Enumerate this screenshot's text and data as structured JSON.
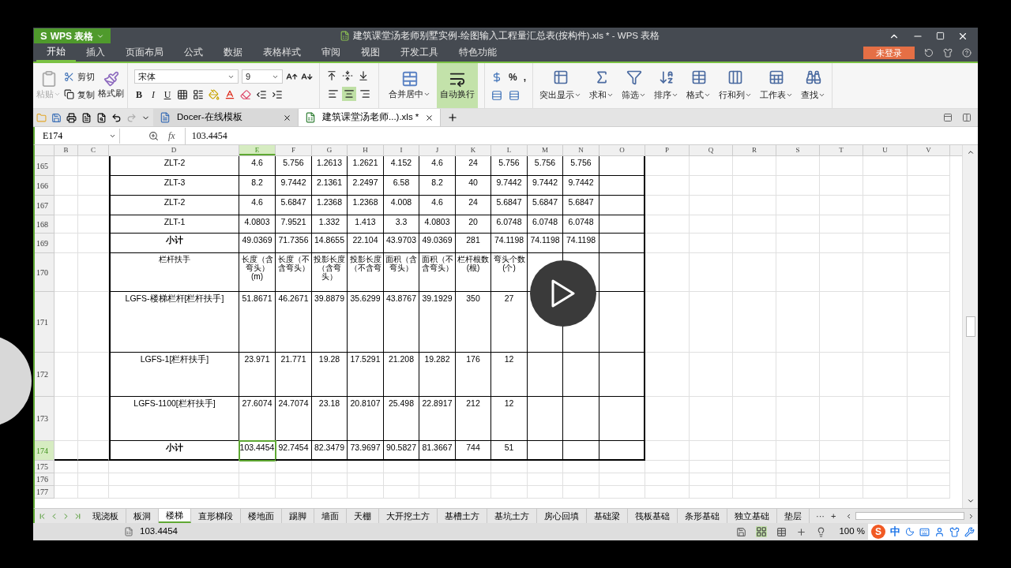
{
  "app": {
    "logo": "S",
    "name": "WPS 表格"
  },
  "window": {
    "title": "建筑课堂汤老师别墅实例-绘图输入工程量汇总表(按构件).xls * - WPS 表格"
  },
  "menu_tabs": [
    {
      "label": "开始",
      "selected": true
    },
    {
      "label": "插入",
      "selected": false
    },
    {
      "label": "页面布局",
      "selected": false
    },
    {
      "label": "公式",
      "selected": false
    },
    {
      "label": "数据",
      "selected": false
    },
    {
      "label": "表格样式",
      "selected": false
    },
    {
      "label": "审阅",
      "selected": false
    },
    {
      "label": "视图",
      "selected": false
    },
    {
      "label": "开发工具",
      "selected": false
    },
    {
      "label": "特色功能",
      "selected": false
    }
  ],
  "login_button": "未登录",
  "ribbon": {
    "paste": {
      "label": "粘贴",
      "disabled": true
    },
    "cut": "剪切",
    "copy": "复制",
    "format_painter": "格式刷",
    "font_name": "宋体",
    "font_size": "9",
    "styles": [
      "B",
      "I",
      "U"
    ],
    "horizontal_align": [
      {
        "selected": false
      },
      {
        "selected": true
      },
      {
        "selected": false
      }
    ],
    "merge": "合并居中",
    "wrap": {
      "label": "自动换行",
      "on": true
    },
    "number_symbols": [
      "%",
      ","
    ],
    "tools": [
      "突出显示",
      "求和",
      "筛选",
      "排序",
      "格式",
      "行和列",
      "工作表",
      "查找"
    ]
  },
  "doc_tabs": [
    {
      "label": "Docer-在线模板",
      "selected": false
    },
    {
      "label": "建筑课堂汤老师...).xls *",
      "selected": true
    }
  ],
  "formula_bar": {
    "name_box": "E174",
    "fx": "fx",
    "value": "103.4454"
  },
  "columns": [
    {
      "label": "B",
      "selected": false
    },
    {
      "label": "C",
      "selected": false
    },
    {
      "label": "D",
      "selected": false
    },
    {
      "label": "E",
      "selected": true
    },
    {
      "label": "F",
      "selected": false
    },
    {
      "label": "G",
      "selected": false
    },
    {
      "label": "H",
      "selected": false
    },
    {
      "label": "I",
      "selected": false
    },
    {
      "label": "J",
      "selected": false
    },
    {
      "label": "K",
      "selected": false
    },
    {
      "label": "L",
      "selected": false
    },
    {
      "label": "M",
      "selected": false
    },
    {
      "label": "N",
      "selected": false
    },
    {
      "label": "O",
      "selected": false
    },
    {
      "label": "P",
      "selected": false
    },
    {
      "label": "Q",
      "selected": false
    },
    {
      "label": "R",
      "selected": false
    },
    {
      "label": "S",
      "selected": false
    },
    {
      "label": "T",
      "selected": false
    },
    {
      "label": "U",
      "selected": false
    },
    {
      "label": "V",
      "selected": false
    }
  ],
  "rows": [
    {
      "number": "165",
      "kind": "data",
      "selected": false,
      "cells": [
        "ZLT-2",
        "4.6",
        "5.756",
        "1.2613",
        "1.2621",
        "4.152",
        "4.6",
        "24",
        "5.756",
        "5.756",
        "5.756"
      ]
    },
    {
      "number": "166",
      "kind": "data",
      "selected": false,
      "cells": [
        "ZLT-3",
        "8.2",
        "9.7442",
        "2.1361",
        "2.2497",
        "6.58",
        "8.2",
        "40",
        "9.7442",
        "9.7442",
        "9.7442"
      ]
    },
    {
      "number": "167",
      "kind": "data",
      "selected": false,
      "cells": [
        "ZLT-2",
        "4.6",
        "5.6847",
        "1.2368",
        "1.2368",
        "4.008",
        "4.6",
        "24",
        "5.6847",
        "5.6847",
        "5.6847"
      ]
    },
    {
      "number": "168",
      "kind": "data",
      "selected": false,
      "cells": [
        "ZLT-1",
        "4.0803",
        "7.9521",
        "1.332",
        "1.413",
        "3.3",
        "4.0803",
        "20",
        "6.0748",
        "6.0748",
        "6.0748"
      ]
    },
    {
      "number": "169",
      "kind": "subtotal",
      "selected": false,
      "cells": [
        "小计",
        "49.0369",
        "71.7356",
        "14.8655",
        "22.104",
        "43.9703",
        "49.0369",
        "281",
        "74.1198",
        "74.1198",
        "74.1198"
      ]
    },
    {
      "number": "170",
      "kind": "header",
      "selected": false,
      "cells": [
        "栏杆扶手",
        "长度（含弯头）(m)",
        "长度（不含弯头）",
        "投影长度（含弯头）",
        "投影长度（不含弯",
        "面积（含弯头）",
        "面积（不含弯头）",
        "栏杆根数(根)",
        "弯头个数(个)"
      ]
    },
    {
      "number": "171",
      "kind": "data",
      "selected": false,
      "cells": [
        "LGFS-楼梯栏杆[栏杆扶手]",
        "51.8671",
        "46.2671",
        "39.8879",
        "35.6299",
        "43.8767",
        "39.1929",
        "350",
        "27"
      ]
    },
    {
      "number": "172",
      "kind": "data",
      "selected": false,
      "cells": [
        "LGFS-1[栏杆扶手]",
        "23.971",
        "21.771",
        "19.28",
        "17.5291",
        "21.208",
        "19.282",
        "176",
        "12"
      ]
    },
    {
      "number": "173",
      "kind": "data",
      "selected": false,
      "cells": [
        "LGFS-1100[栏杆扶手]",
        "27.6074",
        "24.7074",
        "23.18",
        "20.8107",
        "25.498",
        "22.8917",
        "212",
        "12"
      ]
    },
    {
      "number": "174",
      "kind": "subtotal",
      "selected": true,
      "cells": [
        "小计",
        "103.4454",
        "92.7454",
        "82.3479",
        "73.9697",
        "90.5827",
        "81.3667",
        "744",
        "51"
      ]
    },
    {
      "number": "175",
      "kind": "blank",
      "selected": false
    },
    {
      "number": "176",
      "kind": "blank",
      "selected": false
    },
    {
      "number": "177",
      "kind": "blank",
      "selected": false
    }
  ],
  "sheet_tabs": [
    {
      "label": "现浇板",
      "selected": false
    },
    {
      "label": "板洞",
      "selected": false
    },
    {
      "label": "楼梯",
      "selected": true
    },
    {
      "label": "直形梯段",
      "selected": false
    },
    {
      "label": "楼地面",
      "selected": false
    },
    {
      "label": "踢脚",
      "selected": false
    },
    {
      "label": "墙面",
      "selected": false
    },
    {
      "label": "天棚",
      "selected": false
    },
    {
      "label": "大开挖土方",
      "selected": false
    },
    {
      "label": "基槽土方",
      "selected": false
    },
    {
      "label": "基坑土方",
      "selected": false
    },
    {
      "label": "房心回填",
      "selected": false
    },
    {
      "label": "基础梁",
      "selected": false
    },
    {
      "label": "筏板基础",
      "selected": false
    },
    {
      "label": "条形基础",
      "selected": false
    },
    {
      "label": "独立基础",
      "selected": false
    },
    {
      "label": "垫层",
      "selected": false
    }
  ],
  "sheet_tab_actions": [
    "···",
    "+"
  ],
  "status_bar": {
    "value": "103.4454",
    "zoom": "100 %",
    "ime_logo": "S",
    "ime": "中"
  }
}
